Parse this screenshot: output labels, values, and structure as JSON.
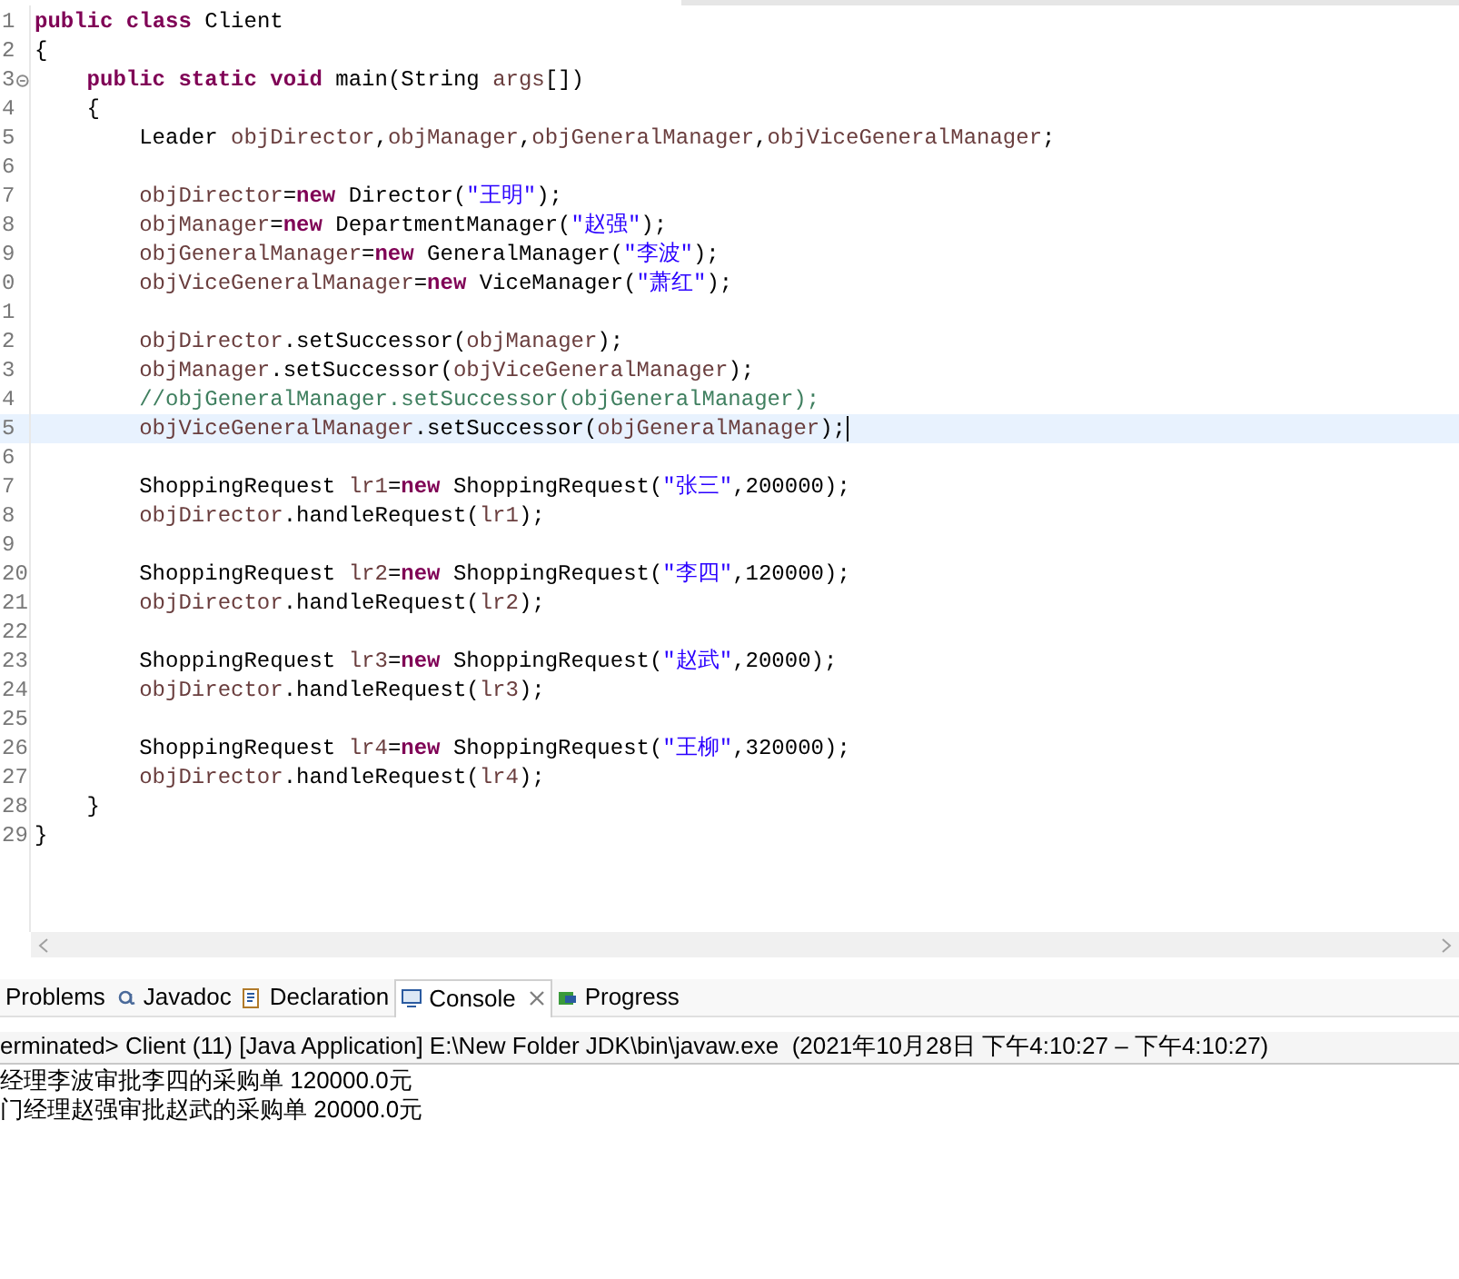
{
  "editor": {
    "lines": [
      {
        "number": "1",
        "current": false,
        "fold": false,
        "tokens": [
          {
            "kind": "keyword",
            "text": "public"
          },
          {
            "kind": "keyword",
            "text": " class"
          },
          {
            "kind": "plain",
            "text": " Client"
          }
        ]
      },
      {
        "number": "2",
        "current": false,
        "fold": false,
        "tokens": [
          {
            "kind": "plain",
            "text": "{"
          }
        ]
      },
      {
        "number": "3",
        "current": false,
        "fold": true,
        "tokens": [
          {
            "kind": "keyword",
            "text": "    public"
          },
          {
            "kind": "keyword",
            "text": " static"
          },
          {
            "kind": "keyword",
            "text": " void"
          },
          {
            "kind": "plain",
            "text": " main(String "
          },
          {
            "kind": "variable",
            "text": "args"
          },
          {
            "kind": "plain",
            "text": "[])"
          }
        ]
      },
      {
        "number": "4",
        "current": false,
        "fold": false,
        "tokens": [
          {
            "kind": "plain",
            "text": "    {"
          }
        ]
      },
      {
        "number": "5",
        "current": false,
        "fold": false,
        "tokens": [
          {
            "kind": "plain",
            "text": "        Leader "
          },
          {
            "kind": "variable",
            "text": "objDirector"
          },
          {
            "kind": "plain",
            "text": ","
          },
          {
            "kind": "variable",
            "text": "objManager"
          },
          {
            "kind": "plain",
            "text": ","
          },
          {
            "kind": "variable",
            "text": "objGeneralManager"
          },
          {
            "kind": "plain",
            "text": ","
          },
          {
            "kind": "variable",
            "text": "objViceGeneralManager"
          },
          {
            "kind": "plain",
            "text": ";"
          }
        ]
      },
      {
        "number": "6",
        "current": false,
        "fold": false
      },
      {
        "number": "7",
        "current": false,
        "fold": false,
        "tokens": [
          {
            "kind": "variable",
            "text": "        objDirector"
          },
          {
            "kind": "plain",
            "text": "="
          },
          {
            "kind": "keyword",
            "text": "new"
          },
          {
            "kind": "plain",
            "text": " Director("
          },
          {
            "kind": "string",
            "text": "\"王明\""
          },
          {
            "kind": "plain",
            "text": ");"
          }
        ]
      },
      {
        "number": "8",
        "current": false,
        "fold": false,
        "tokens": [
          {
            "kind": "variable",
            "text": "        objManager"
          },
          {
            "kind": "plain",
            "text": "="
          },
          {
            "kind": "keyword",
            "text": "new"
          },
          {
            "kind": "plain",
            "text": " DepartmentManager("
          },
          {
            "kind": "string",
            "text": "\"赵强\""
          },
          {
            "kind": "plain",
            "text": ");"
          }
        ]
      },
      {
        "number": "9",
        "current": false,
        "fold": false,
        "tokens": [
          {
            "kind": "variable",
            "text": "        objGeneralManager"
          },
          {
            "kind": "plain",
            "text": "="
          },
          {
            "kind": "keyword",
            "text": "new"
          },
          {
            "kind": "plain",
            "text": " GeneralManager("
          },
          {
            "kind": "string",
            "text": "\"李波\""
          },
          {
            "kind": "plain",
            "text": ");"
          }
        ]
      },
      {
        "number": "0",
        "current": false,
        "fold": false,
        "tokens": [
          {
            "kind": "variable",
            "text": "        objViceGeneralManager"
          },
          {
            "kind": "plain",
            "text": "="
          },
          {
            "kind": "keyword",
            "text": "new"
          },
          {
            "kind": "plain",
            "text": " ViceManager("
          },
          {
            "kind": "string",
            "text": "\"萧红\""
          },
          {
            "kind": "plain",
            "text": ");"
          }
        ]
      },
      {
        "number": "1",
        "current": false,
        "fold": false
      },
      {
        "number": "2",
        "current": false,
        "fold": false,
        "tokens": [
          {
            "kind": "variable",
            "text": "        objDirector"
          },
          {
            "kind": "plain",
            "text": ".setSuccessor("
          },
          {
            "kind": "variable",
            "text": "objManager"
          },
          {
            "kind": "plain",
            "text": ");"
          }
        ]
      },
      {
        "number": "3",
        "current": false,
        "fold": false,
        "tokens": [
          {
            "kind": "variable",
            "text": "        objManager"
          },
          {
            "kind": "plain",
            "text": ".setSuccessor("
          },
          {
            "kind": "variable",
            "text": "objViceGeneralManager"
          },
          {
            "kind": "plain",
            "text": ");"
          }
        ]
      },
      {
        "number": "4",
        "current": false,
        "fold": false,
        "tokens": [
          {
            "kind": "comment",
            "text": "        //objGeneralManager.setSuccessor(objGeneralManager);"
          }
        ]
      },
      {
        "number": "5",
        "current": true,
        "fold": false,
        "tokens": [
          {
            "kind": "variable",
            "text": "        objViceGeneralManager"
          },
          {
            "kind": "plain",
            "text": ".setSuccessor("
          },
          {
            "kind": "variable",
            "text": "objGeneralManager"
          },
          {
            "kind": "plain",
            "text": ");"
          }
        ]
      },
      {
        "number": "6",
        "current": false,
        "fold": false
      },
      {
        "number": "7",
        "current": false,
        "fold": false,
        "tokens": [
          {
            "kind": "plain",
            "text": "        ShoppingRequest "
          },
          {
            "kind": "variable",
            "text": "lr1"
          },
          {
            "kind": "plain",
            "text": "="
          },
          {
            "kind": "keyword",
            "text": "new"
          },
          {
            "kind": "plain",
            "text": " ShoppingRequest("
          },
          {
            "kind": "string",
            "text": "\"张三\""
          },
          {
            "kind": "plain",
            "text": ",200000);"
          }
        ]
      },
      {
        "number": "8",
        "current": false,
        "fold": false,
        "tokens": [
          {
            "kind": "variable",
            "text": "        objDirector"
          },
          {
            "kind": "plain",
            "text": ".handleRequest("
          },
          {
            "kind": "variable",
            "text": "lr1"
          },
          {
            "kind": "plain",
            "text": ");"
          }
        ]
      },
      {
        "number": "9",
        "current": false,
        "fold": false
      },
      {
        "number": "20",
        "current": false,
        "fold": false,
        "tokens": [
          {
            "kind": "plain",
            "text": "        ShoppingRequest "
          },
          {
            "kind": "variable",
            "text": "lr2"
          },
          {
            "kind": "plain",
            "text": "="
          },
          {
            "kind": "keyword",
            "text": "new"
          },
          {
            "kind": "plain",
            "text": " ShoppingRequest("
          },
          {
            "kind": "string",
            "text": "\"李四\""
          },
          {
            "kind": "plain",
            "text": ",120000);"
          }
        ]
      },
      {
        "number": "21",
        "current": false,
        "fold": false,
        "tokens": [
          {
            "kind": "variable",
            "text": "        objDirector"
          },
          {
            "kind": "plain",
            "text": ".handleRequest("
          },
          {
            "kind": "variable",
            "text": "lr2"
          },
          {
            "kind": "plain",
            "text": ");"
          }
        ]
      },
      {
        "number": "22",
        "current": false,
        "fold": false
      },
      {
        "number": "23",
        "current": false,
        "fold": false,
        "tokens": [
          {
            "kind": "plain",
            "text": "        ShoppingRequest "
          },
          {
            "kind": "variable",
            "text": "lr3"
          },
          {
            "kind": "plain",
            "text": "="
          },
          {
            "kind": "keyword",
            "text": "new"
          },
          {
            "kind": "plain",
            "text": " ShoppingRequest("
          },
          {
            "kind": "string",
            "text": "\"赵武\""
          },
          {
            "kind": "plain",
            "text": ",20000);"
          }
        ]
      },
      {
        "number": "24",
        "current": false,
        "fold": false,
        "tokens": [
          {
            "kind": "variable",
            "text": "        objDirector"
          },
          {
            "kind": "plain",
            "text": ".handleRequest("
          },
          {
            "kind": "variable",
            "text": "lr3"
          },
          {
            "kind": "plain",
            "text": ");"
          }
        ]
      },
      {
        "number": "25",
        "current": false,
        "fold": false
      },
      {
        "number": "26",
        "current": false,
        "fold": false,
        "tokens": [
          {
            "kind": "plain",
            "text": "        ShoppingRequest "
          },
          {
            "kind": "variable",
            "text": "lr4"
          },
          {
            "kind": "plain",
            "text": "="
          },
          {
            "kind": "keyword",
            "text": "new"
          },
          {
            "kind": "plain",
            "text": " ShoppingRequest("
          },
          {
            "kind": "string",
            "text": "\"王柳\""
          },
          {
            "kind": "plain",
            "text": ",320000);"
          }
        ]
      },
      {
        "number": "27",
        "current": false,
        "fold": false,
        "tokens": [
          {
            "kind": "variable",
            "text": "        objDirector"
          },
          {
            "kind": "plain",
            "text": ".handleRequest("
          },
          {
            "kind": "variable",
            "text": "lr4"
          },
          {
            "kind": "plain",
            "text": ");"
          }
        ]
      },
      {
        "number": "28",
        "current": false,
        "fold": false,
        "tokens": [
          {
            "kind": "plain",
            "text": "    }"
          }
        ]
      },
      {
        "number": "29",
        "current": false,
        "fold": false,
        "tokens": [
          {
            "kind": "plain",
            "text": "}"
          }
        ]
      }
    ]
  },
  "bottom_panel": {
    "tabs": [
      {
        "label": "Problems",
        "selected": false
      },
      {
        "label": "Javadoc",
        "selected": false
      },
      {
        "label": "Declaration",
        "selected": false
      },
      {
        "label": "Console",
        "selected": true
      },
      {
        "label": "Progress",
        "selected": false
      }
    ],
    "console": {
      "header": "erminated> Client (11) [Java Application] E:\\New Folder JDK\\bin\\javaw.exe  (2021年10月28日 下午4:10:27 – 下午4:10:27)",
      "output": [
        "经理李波审批李四的采购单 120000.0元",
        "门经理赵强审批赵武的采购单 20000.0元"
      ]
    }
  }
}
